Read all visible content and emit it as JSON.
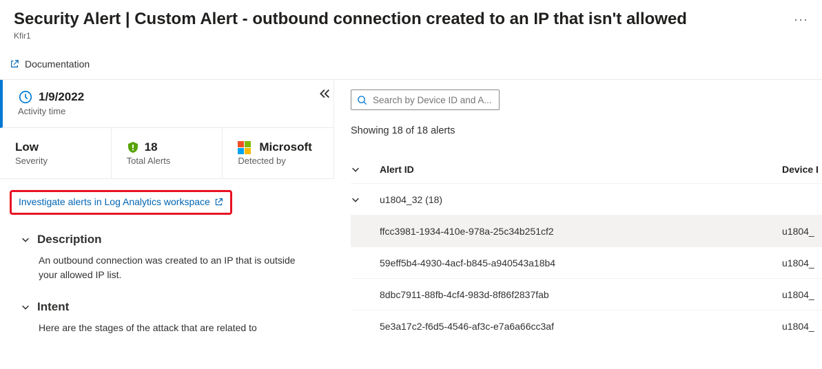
{
  "header": {
    "title": "Security Alert | Custom Alert - outbound connection created to an IP that isn't allowed",
    "subtitle": "Kfir1",
    "more_label": "···"
  },
  "doc_link": "Documentation",
  "overview": {
    "activity_time": {
      "value": "1/9/2022",
      "label": "Activity time"
    },
    "severity": {
      "value": "Low",
      "label": "Severity"
    },
    "total_alerts": {
      "value": "18",
      "label": "Total Alerts"
    },
    "detected_by": {
      "value": "Microsoft",
      "label": "Detected by"
    }
  },
  "investigate_link": "Investigate alerts in Log Analytics workspace",
  "sections": {
    "description": {
      "title": "Description",
      "body": "An outbound connection was created to an IP that is outside your allowed IP list."
    },
    "intent": {
      "title": "Intent",
      "body": "Here are the stages of the attack that are related to"
    }
  },
  "search": {
    "placeholder": "Search by Device ID and A..."
  },
  "showing_text": "Showing 18 of 18 alerts",
  "table": {
    "headers": {
      "alert_id": "Alert ID",
      "device": "Device I"
    },
    "group": {
      "label": "u1804_32 (18)"
    },
    "rows": [
      {
        "alert_id": "ffcc3981-1934-410e-978a-25c34b251cf2",
        "device": "u1804_"
      },
      {
        "alert_id": "59eff5b4-4930-4acf-b845-a940543a18b4",
        "device": "u1804_"
      },
      {
        "alert_id": "8dbc7911-88fb-4cf4-983d-8f86f2837fab",
        "device": "u1804_"
      },
      {
        "alert_id": "5e3a17c2-f6d5-4546-af3c-e7a6a66cc3af",
        "device": "u1804_"
      }
    ]
  }
}
